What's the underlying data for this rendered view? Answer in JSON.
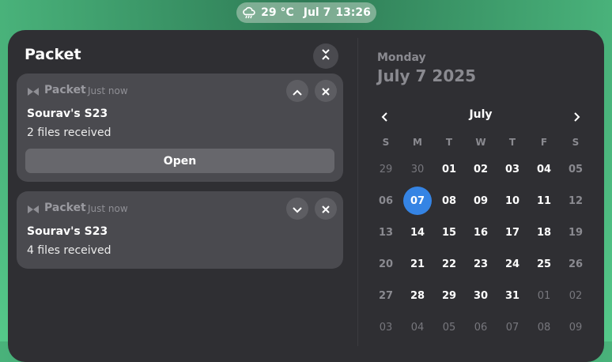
{
  "top_bar": {
    "weather_icon": "cloud-rain-icon",
    "temperature": "29 °C",
    "date": "Jul 7",
    "time": "13:26"
  },
  "notifications": {
    "title": "Packet",
    "clear_icon": "collapse-icon",
    "cards": [
      {
        "app_icon": "packet-icon",
        "app_name": "Packet",
        "time": "Just now",
        "toggle_icon": "chevron-up-icon",
        "close_icon": "close-icon",
        "title": "Sourav's S23",
        "body": "2 files received",
        "action_label": "Open"
      },
      {
        "app_icon": "packet-icon",
        "app_name": "Packet",
        "time": "Just now",
        "toggle_icon": "chevron-down-icon",
        "close_icon": "close-icon",
        "title": "Sourav's S23",
        "body": "4 files received"
      }
    ]
  },
  "calendar": {
    "day_name": "Monday",
    "full_date": "July 7 2025",
    "month": "July",
    "prev_icon": "chevron-left-icon",
    "next_icon": "chevron-right-icon",
    "weekdays": [
      "S",
      "M",
      "T",
      "W",
      "T",
      "F",
      "S"
    ],
    "today": "07",
    "weeks": [
      [
        "29",
        "30",
        "01",
        "02",
        "03",
        "04",
        "05"
      ],
      [
        "06",
        "07",
        "08",
        "09",
        "10",
        "11",
        "12"
      ],
      [
        "13",
        "14",
        "15",
        "16",
        "17",
        "18",
        "19"
      ],
      [
        "20",
        "21",
        "22",
        "23",
        "24",
        "25",
        "26"
      ],
      [
        "27",
        "28",
        "29",
        "30",
        "31",
        "01",
        "02"
      ],
      [
        "03",
        "04",
        "05",
        "06",
        "07",
        "08",
        "09"
      ]
    ],
    "other_month_cells": [
      [
        0,
        0
      ],
      [
        0,
        1
      ],
      [
        4,
        5
      ],
      [
        4,
        6
      ],
      [
        5,
        0
      ],
      [
        5,
        1
      ],
      [
        5,
        2
      ],
      [
        5,
        3
      ],
      [
        5,
        4
      ],
      [
        5,
        5
      ],
      [
        5,
        6
      ]
    ],
    "today_cell": [
      1,
      1
    ],
    "colors": {
      "accent": "#3584e4",
      "panel": "#2f2f33",
      "card": "#4a4a4f"
    }
  }
}
